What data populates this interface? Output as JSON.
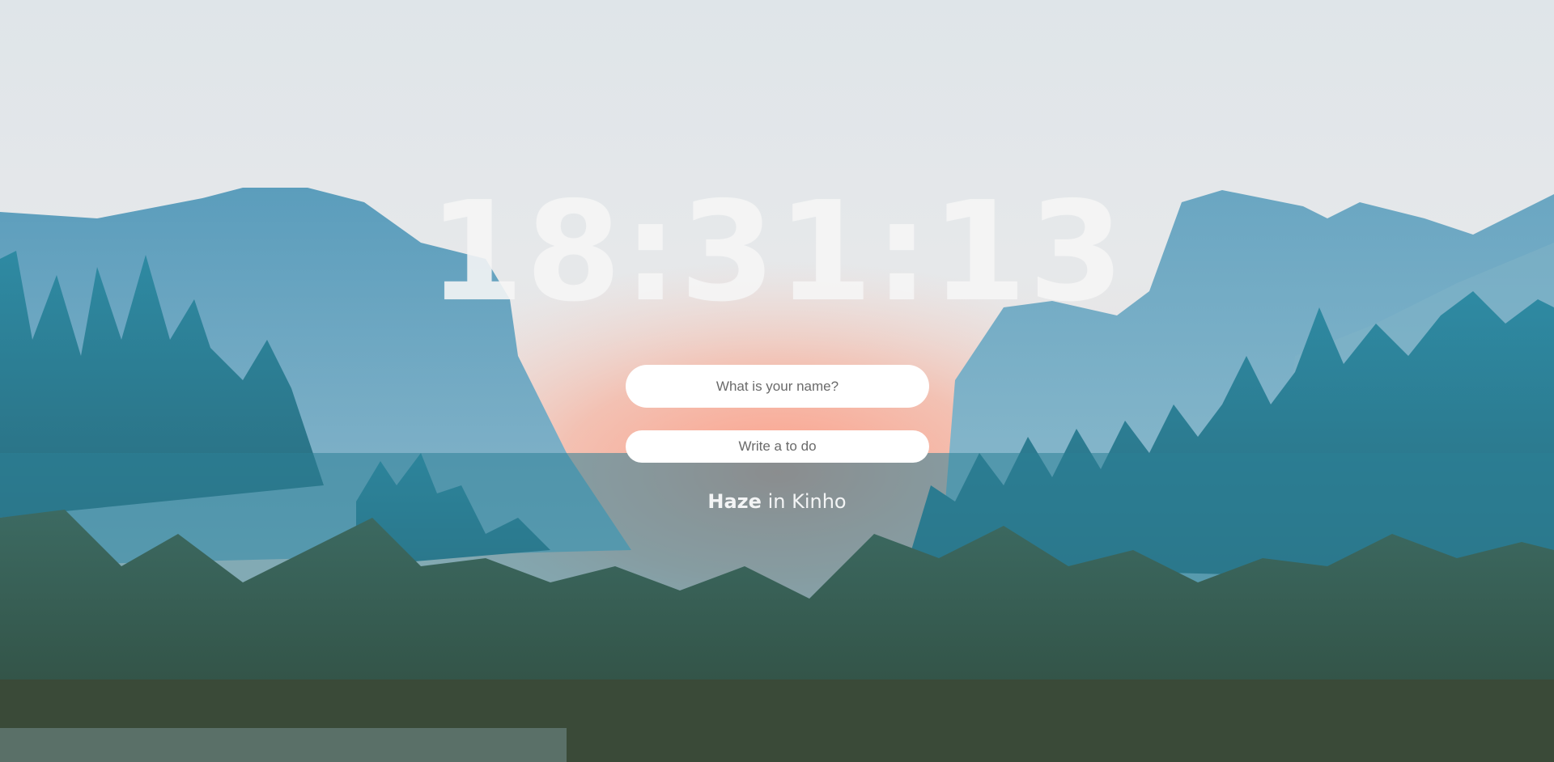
{
  "clock": {
    "time": "18:31:13"
  },
  "name_form": {
    "placeholder": "What is your name?"
  },
  "todo_form": {
    "placeholder": "Write a to do"
  },
  "photo_credit": {
    "title": "Haze",
    "separator": "in",
    "location": "Kinho"
  },
  "colors": {
    "sky_top": "#e3e7ea",
    "sunset_glow": "#f6a98e",
    "mountain_blue": "#5f9fbd",
    "forest_teal": "#2f7f95",
    "foreground_green": "#3e5b4a"
  }
}
